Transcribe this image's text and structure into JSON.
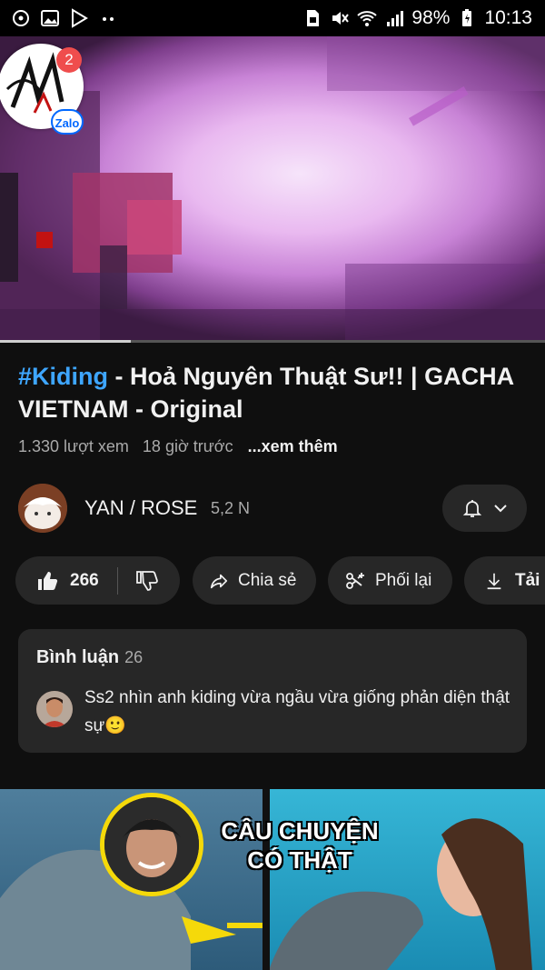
{
  "status_bar": {
    "battery": "98%",
    "time": "10:13",
    "icons_left": [
      "podcast-icon",
      "image-icon",
      "play-store-icon",
      "more-dots-icon"
    ],
    "icons_right": [
      "sim-icon",
      "mute-icon",
      "wifi-icon",
      "signal-icon",
      "battery-icon"
    ]
  },
  "player": {
    "progress": 0.24
  },
  "zalo_bubble": {
    "badge_count": "2",
    "tag": "Zalo"
  },
  "video": {
    "hashtag": "#Kiding",
    "title_rest": " - Hoả Nguyên Thuật Sư!! | GACHA VIETNAM - Original",
    "views": "1.330 lượt xem",
    "time_ago": "18 giờ trước",
    "more_label": "...xem thêm"
  },
  "channel": {
    "name": "YAN / ROSE",
    "subscribers": "5,2 N"
  },
  "actions": {
    "like_count": "266",
    "share_label": "Chia sẻ",
    "remix_label": "Phối lại",
    "download_label": "Tải"
  },
  "comments": {
    "heading": "Bình luận",
    "count": "26",
    "top_comment": "Ss2 nhìn anh kiding vừa ngầu vừa giống phản diện thật sự🙂"
  },
  "next_video": {
    "thumbnail_caption_line1": "CÂU CHUYỆN",
    "thumbnail_caption_line2": "CÓ THẬT"
  },
  "colors": {
    "background": "#0f0f0f",
    "pill": "#272727",
    "hashtag": "#3ea6ff",
    "secondary_text": "#aaaaaa"
  }
}
